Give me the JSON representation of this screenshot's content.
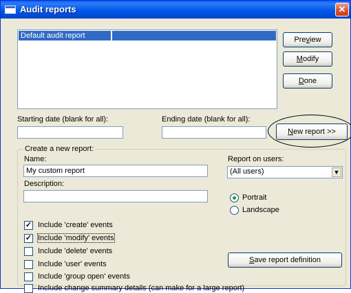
{
  "window": {
    "title": "Audit reports",
    "close_glyph": "✕"
  },
  "reports_list": {
    "items": [
      "Default audit report"
    ]
  },
  "buttons": {
    "preview": {
      "pre": "Pre",
      "hot": "v",
      "post": "iew"
    },
    "modify": {
      "pre": "",
      "hot": "M",
      "post": "odify"
    },
    "done": {
      "pre": "",
      "hot": "D",
      "post": "one"
    },
    "new_report": {
      "pre": "",
      "hot": "N",
      "post": "ew report >>"
    },
    "save": {
      "pre": "",
      "hot": "S",
      "post": "ave report definition"
    }
  },
  "dates": {
    "start_label": "Starting date (blank for all):",
    "start_value": "",
    "end_label": "Ending date (blank for all):",
    "end_value": ""
  },
  "create_group": {
    "legend": "Create a new report:",
    "name_label": "Name:",
    "name_value": "My custom report",
    "description_label": "Description:",
    "description_value": "",
    "users_label": "Report on users:",
    "users_value": "(All users)"
  },
  "orientation": [
    {
      "label": "Portrait",
      "selected": true
    },
    {
      "label": "Landscape",
      "selected": false
    }
  ],
  "checkboxes": [
    {
      "label": "Include 'create' events",
      "checked": true
    },
    {
      "label": "Include 'modify' events",
      "checked": true
    },
    {
      "label": "Include 'delete' events",
      "checked": false
    },
    {
      "label": "Include 'user' events",
      "checked": false
    },
    {
      "label": "Include 'group open' events",
      "checked": false
    },
    {
      "label": "Include change summary details (can make for a large report)",
      "checked": false
    }
  ],
  "colors": {
    "title_bar": "#0058E6",
    "dialog_bg": "#ECE9D8",
    "selection": "#316AC5"
  },
  "icons": {
    "window_icon": "window-icon",
    "close": "close-icon",
    "dropdown": "chevron-down-icon",
    "check": "check-icon"
  }
}
